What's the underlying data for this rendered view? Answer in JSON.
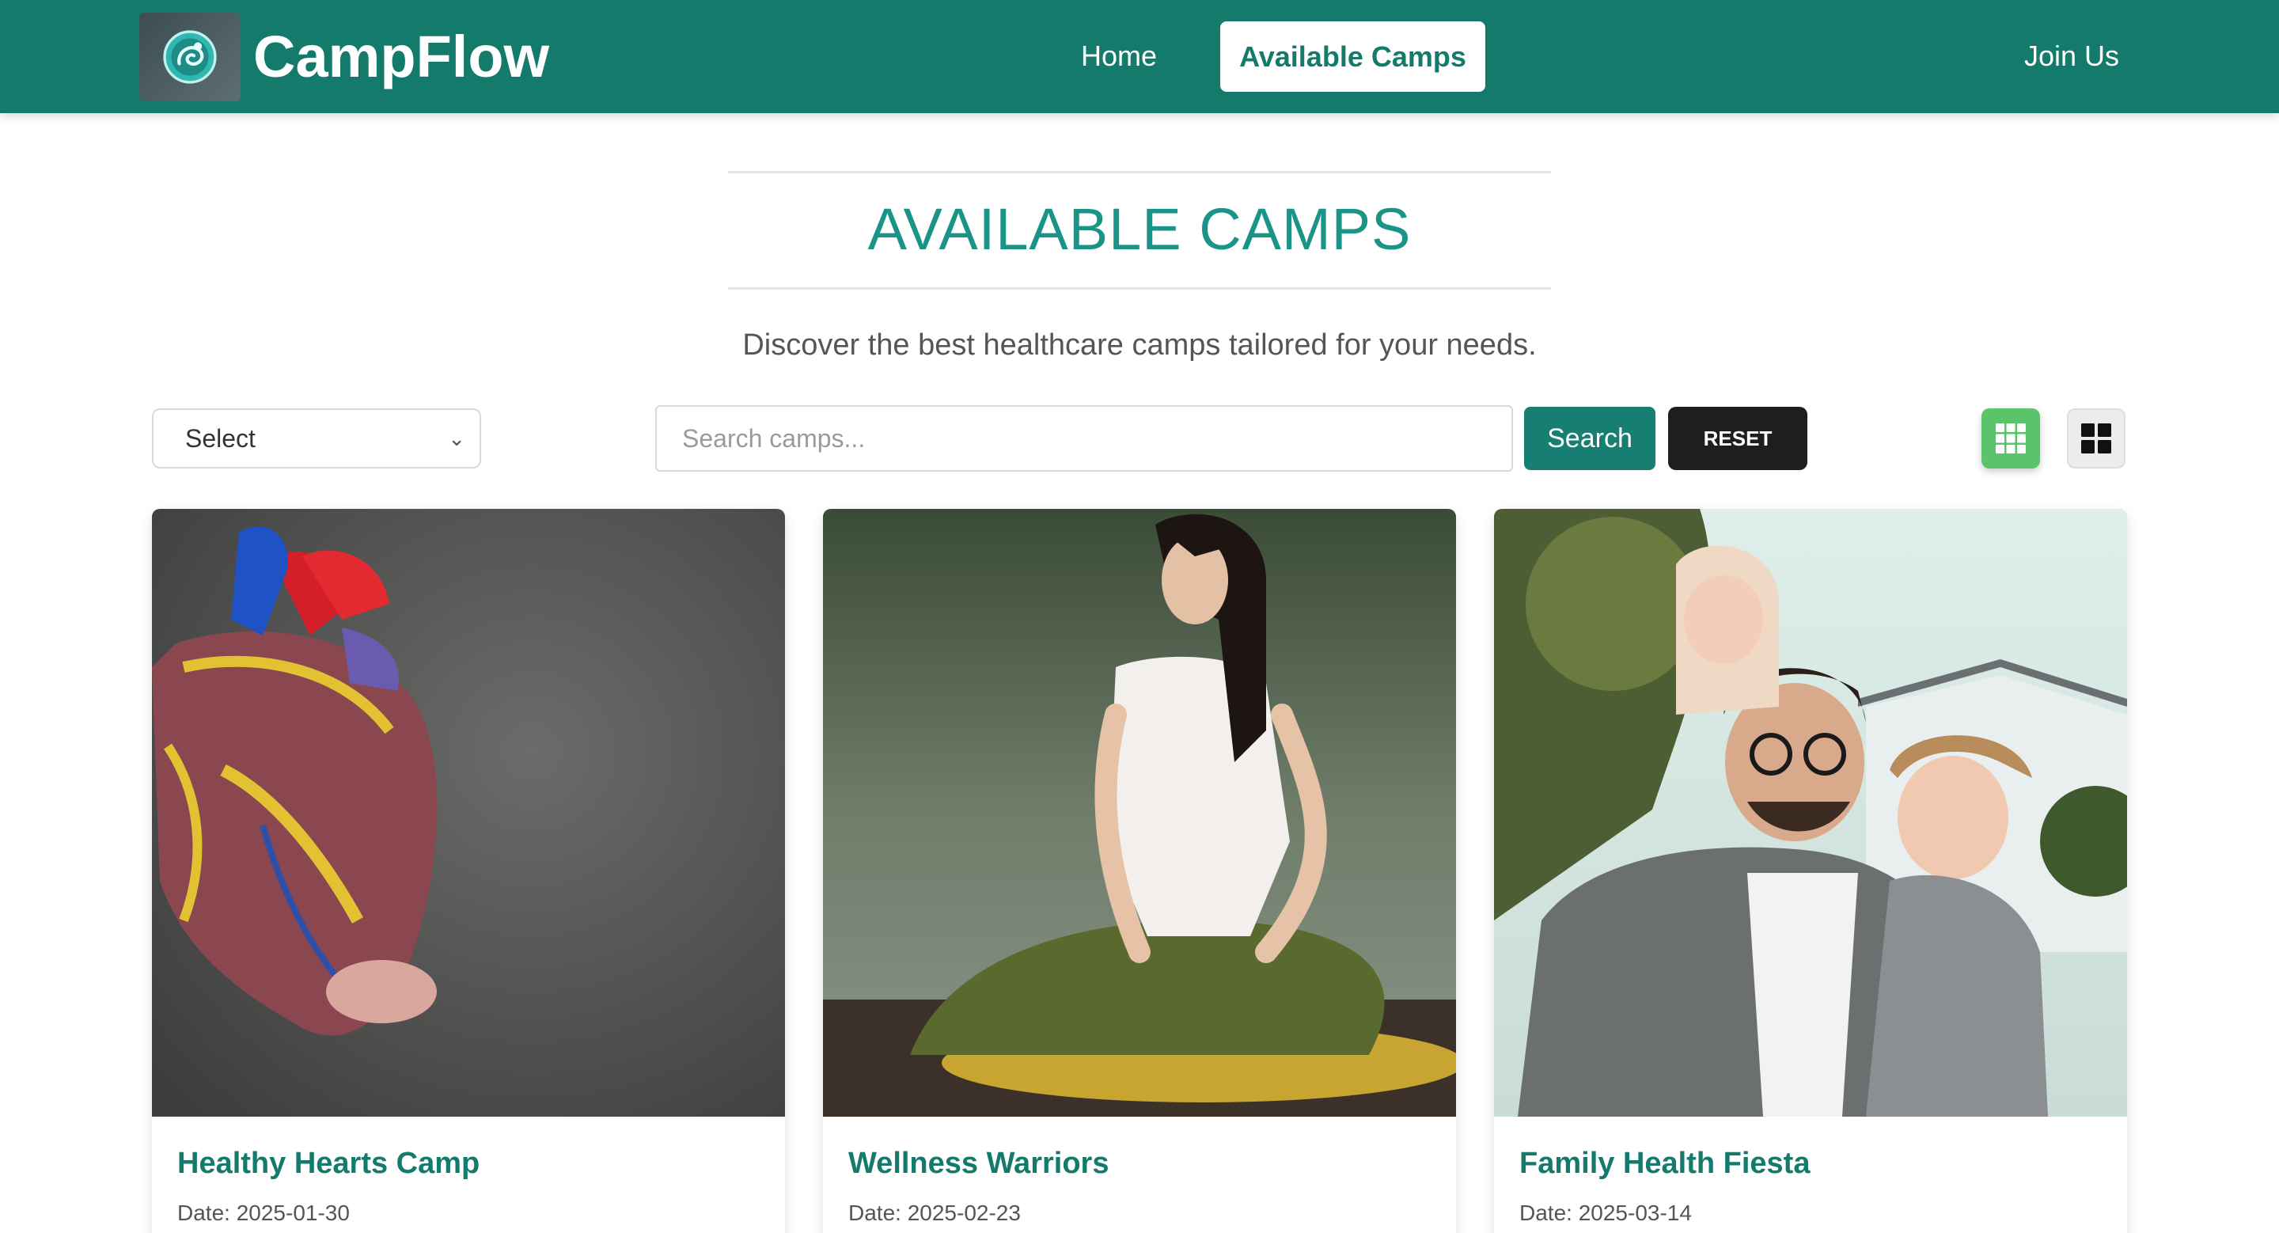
{
  "navbar": {
    "brand": "CampFlow",
    "links": [
      {
        "label": "Home"
      },
      {
        "label": "Available Camps",
        "active": true
      },
      {
        "label": "Join Us"
      }
    ]
  },
  "header": {
    "title": "AVAILABLE CAMPS",
    "subtitle": "Discover the best healthcare camps tailored for your needs."
  },
  "controls": {
    "sort_select": {
      "selected": "Select"
    },
    "search": {
      "placeholder": "Search camps...",
      "value": ""
    },
    "search_button": "Search",
    "reset_button": "RESET",
    "layout_options": [
      "three-column-grid",
      "two-column-grid"
    ],
    "active_layout": "three-column-grid"
  },
  "camps": [
    {
      "name": "Healthy Hearts Camp",
      "date": "Date: 2025-01-30",
      "image": "anatomical-heart-model"
    },
    {
      "name": "Wellness Warriors",
      "date": "Date: 2025-02-23",
      "image": "woman-meditating-by-water"
    },
    {
      "name": "Family Health Fiesta",
      "date": "Date: 2025-03-14",
      "image": "father-with-two-children"
    }
  ],
  "colors": {
    "primary": "#147A6C",
    "title_teal": "#1a9486",
    "grid_toggle_active": "#5bc46a",
    "reset_dark": "#1e1e1e"
  }
}
